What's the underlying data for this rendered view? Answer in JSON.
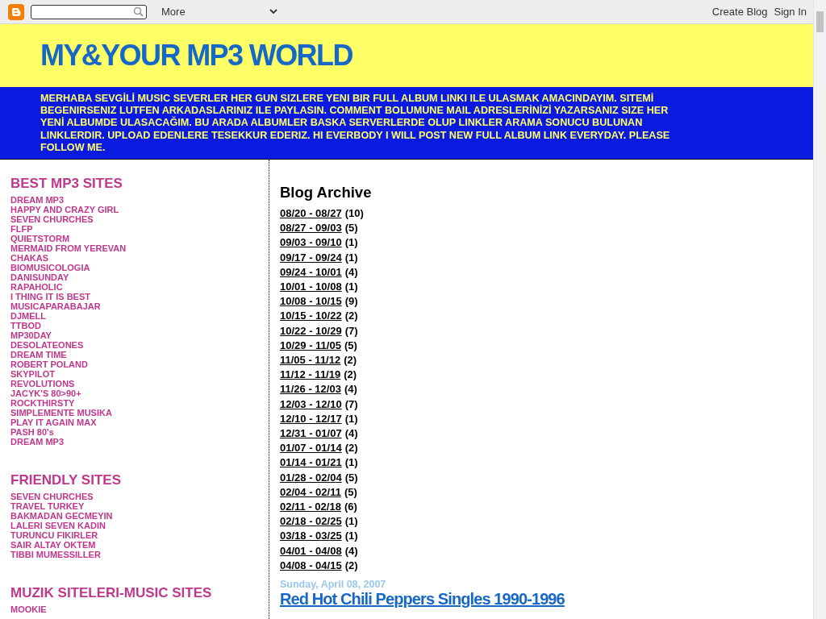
{
  "navbar": {
    "more": "More",
    "links": [
      "Create Blog",
      "Sign In"
    ]
  },
  "header": {
    "title": "MY&YOUR MP3 WORLD",
    "description": "MERHABA SEVGİLİ MUSIC SEVERLER HER GUN SIZLERE YENI BIR FULL ALBUM LINKI ILE ULASMAK AMACINDAYIM. SITEMİ BEGENIRSENIZ LUTFEN ARKADASLARINIZ ILE PAYLASIN. COMMENT BOLUMUNE MAIL ADRESLERİNİZİ YAZARSANIZ SIZE HER YENİ ALBUMDE ULASACAĞIM. BU ARADA ALBUMLER BASKA SERVERLERDE OLUP LINKLER ARAMA SONUCU BULUNAN LINKLERDIR. UPLOAD EDENLERE TESEKKUR EDERIZ. HI EVERBODY I WILL POST NEW FULL ALBUM LINK EVERYDAY. PLEASE FOLLOW ME."
  },
  "sidebar": {
    "sections": [
      {
        "title": "BEST MP3 SITES",
        "links": [
          "DREAM MP3",
          "HAPPY AND CRAZY GIRL",
          "SEVEN CHURCHES",
          "FLFP",
          "QUIETSTORM",
          "MERMAID FROM YEREVAN",
          "CHAKAS",
          "BIOMUSICOLOGIA",
          "DANISUNDAY",
          "RAPAHOLIC",
          "I THING IT IS BEST",
          "MUSICAPARABAJAR",
          "DJMELL",
          "TTBOD",
          "MP30DAY",
          "DESOLATEONES",
          "DREAM TIME",
          "ROBERT POLAND",
          "SKYPILOT",
          "REVOLUTIONS",
          "JACYK'S 80>90+",
          "ROCKTHIRSTY",
          "SIMPLEMENTE MUSIKA",
          "PLAY IT AGAIN MAX",
          "PASH 80's",
          "DREAM MP3"
        ]
      },
      {
        "title": "FRIENDLY SITES",
        "links": [
          "SEVEN CHURCHES",
          "TRAVEL TURKEY",
          "BAKMADAN GECMEYIN",
          "LALERI SEVEN KADIN",
          "TURUNCU FIKIRLER",
          "SAIR ALTAY OKTEM",
          "TIBBI MUMESSILLER"
        ]
      },
      {
        "title": "MUZIK SITELERI-MUSIC SITES",
        "links": [
          "MOOKIE"
        ]
      }
    ]
  },
  "archive": {
    "title": "Blog Archive",
    "items": [
      {
        "range": "08/20 - 08/27",
        "count": "(10)"
      },
      {
        "range": "08/27 - 09/03",
        "count": "(5)"
      },
      {
        "range": "09/03 - 09/10",
        "count": "(1)"
      },
      {
        "range": "09/17 - 09/24",
        "count": "(1)"
      },
      {
        "range": "09/24 - 10/01",
        "count": "(4)"
      },
      {
        "range": "10/01 - 10/08",
        "count": "(1)"
      },
      {
        "range": "10/08 - 10/15",
        "count": "(9)"
      },
      {
        "range": "10/15 - 10/22",
        "count": "(2)"
      },
      {
        "range": "10/22 - 10/29",
        "count": "(7)"
      },
      {
        "range": "10/29 - 11/05",
        "count": "(5)"
      },
      {
        "range": "11/05 - 11/12",
        "count": "(2)"
      },
      {
        "range": "11/12 - 11/19",
        "count": "(2)"
      },
      {
        "range": "11/26 - 12/03",
        "count": "(4)"
      },
      {
        "range": "12/03 - 12/10",
        "count": "(7)"
      },
      {
        "range": "12/10 - 12/17",
        "count": "(1)"
      },
      {
        "range": "12/31 - 01/07",
        "count": "(4)"
      },
      {
        "range": "01/07 - 01/14",
        "count": "(2)"
      },
      {
        "range": "01/14 - 01/21",
        "count": "(1)"
      },
      {
        "range": "01/28 - 02/04",
        "count": "(5)"
      },
      {
        "range": "02/04 - 02/11",
        "count": "(5)"
      },
      {
        "range": "02/11 - 02/18",
        "count": "(6)"
      },
      {
        "range": "02/18 - 02/25",
        "count": "(1)"
      },
      {
        "range": "03/18 - 03/25",
        "count": "(1)"
      },
      {
        "range": "04/01 - 04/08",
        "count": "(4)"
      },
      {
        "range": "04/08 - 04/15",
        "count": "(2)"
      }
    ]
  },
  "post": {
    "date": "Sunday, April 08, 2007",
    "title": "Red Hot Chili Peppers Singles 1990-1996"
  }
}
